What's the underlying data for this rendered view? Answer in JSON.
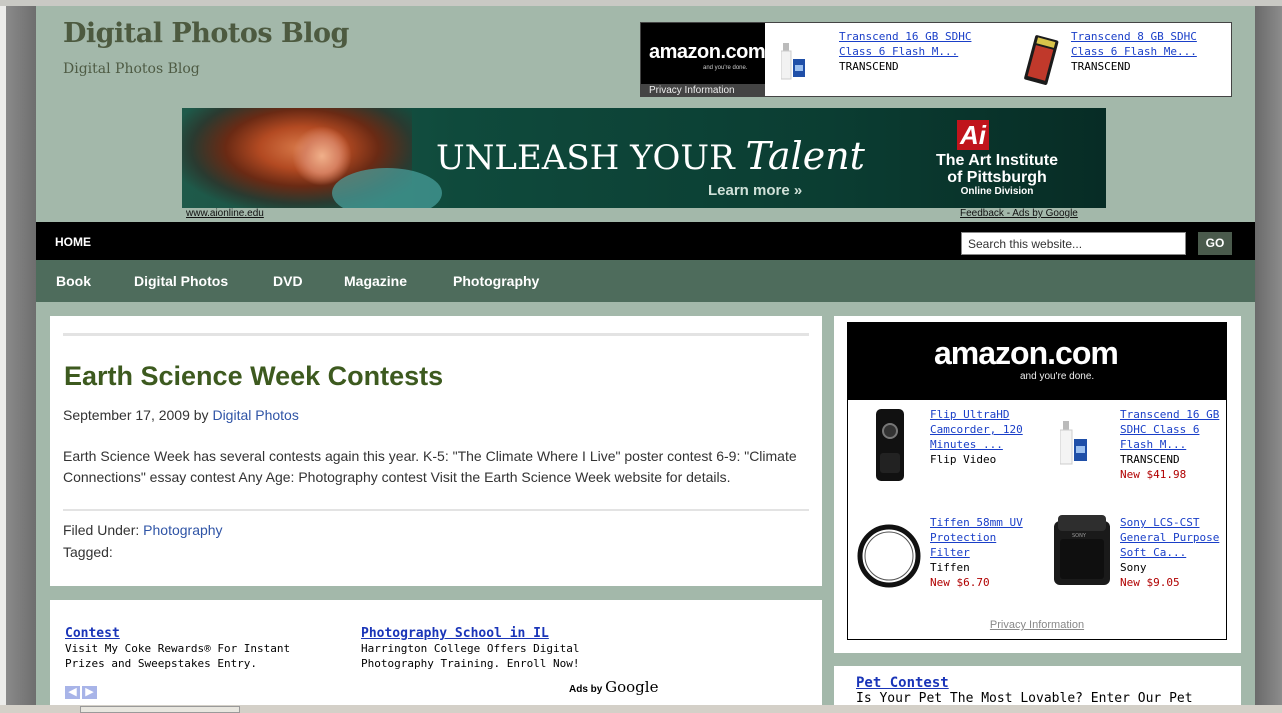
{
  "blog": {
    "title": "Digital Photos Blog",
    "description": "Digital Photos Blog"
  },
  "top_amazon": {
    "logo": "amazon.com",
    "tagline": "and you're done.",
    "privacy": "Privacy Information",
    "products": [
      {
        "title": "Transcend 16 GB SDHC Class 6 Flash M...",
        "brand": "TRANSCEND",
        "icon": "usb-card-reader-icon"
      },
      {
        "title": "Transcend 8 GB SDHC Class 6 Flash Me...",
        "brand": "TRANSCEND",
        "icon": "sd-card-icon"
      }
    ]
  },
  "banner": {
    "headline_a": "UNLEASH YOUR",
    "headline_b": "Talent",
    "cta": "Learn more »",
    "logo": "Ai",
    "institute_line1": "The Art Institute",
    "institute_line2": "of Pittsburgh",
    "institute_line3": "Online Division",
    "url": "www.aionline.edu",
    "feedback": "Feedback - Ads by Google"
  },
  "nav": {
    "home": "HOME",
    "search_placeholder": "Search this website...",
    "go": "GO",
    "categories": [
      "Book",
      "Digital Photos",
      "DVD",
      "Magazine",
      "Photography"
    ]
  },
  "post": {
    "title": "Earth Science Week Contests",
    "date": "September 17, 2009",
    "by": "by",
    "author": "Digital Photos",
    "body": "Earth Science Week has several contests again this year. K-5: \"The Climate Where I Live\" poster contest 6-9: \"Climate Connections\" essay contest Any Age: Photography contest Visit the Earth Science Week website for details.",
    "filed_label": "Filed Under:",
    "filed_value": "Photography",
    "tagged_label": "Tagged:"
  },
  "ads": {
    "items": [
      {
        "title": "Contest",
        "text": "Visit My Coke Rewards® For Instant Prizes and Sweepstakes Entry."
      },
      {
        "title": "Photography School in IL",
        "text": "Harrington College Offers Digital Photography Training. Enroll Now!"
      }
    ],
    "ads_by": "Ads by",
    "google": "Google"
  },
  "side_amazon": {
    "logo": "amazon.com",
    "tagline": "and you're done.",
    "privacy": "Privacy Information",
    "products": [
      {
        "title": "Flip UltraHD Camcorder, 120 Minutes ...",
        "brand": "Flip Video",
        "price": "",
        "icon": "camcorder-icon"
      },
      {
        "title": "Transcend 16 GB SDHC Class 6 Flash M...",
        "brand": "TRANSCEND",
        "price": "New $41.98",
        "icon": "usb-card-reader-icon"
      },
      {
        "title": "Tiffen 58mm UV Protection Filter",
        "brand": "Tiffen",
        "price": "New $6.70",
        "icon": "lens-filter-icon"
      },
      {
        "title": "Sony LCS-CST General Purpose Soft Ca...",
        "brand": "Sony",
        "price": "New $9.05",
        "icon": "camera-case-icon"
      }
    ]
  },
  "side_ad": {
    "title": "Pet Contest",
    "text": "Is Your Pet The Most Lovable? Enter Our Pet"
  },
  "colors": {
    "page_bg": "#a3b8aa",
    "nav_dark": "#000000",
    "nav_green": "#4e6c5c",
    "title_green": "#3d5a1f",
    "link_blue": "#2f54a6"
  }
}
